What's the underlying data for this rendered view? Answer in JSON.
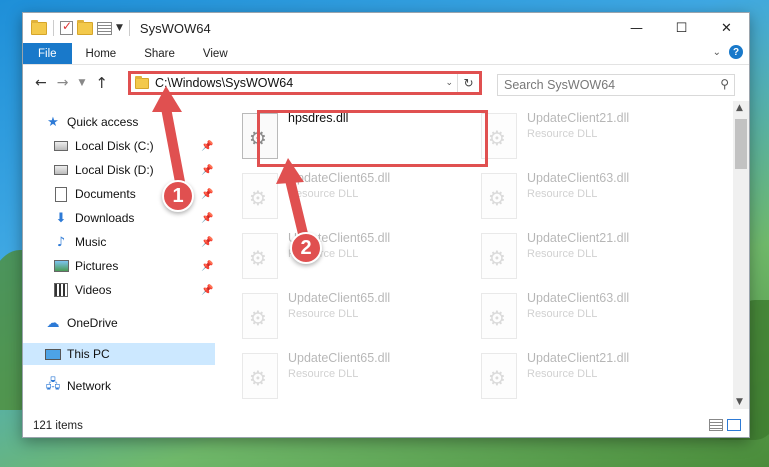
{
  "window": {
    "title": "SysWOW64",
    "controls": [
      "—",
      "☐",
      "✕"
    ]
  },
  "ribbon": {
    "tabs": [
      "File",
      "Home",
      "Share",
      "View"
    ],
    "help": "?"
  },
  "address": {
    "path": "C:\\Windows\\SysWOW64",
    "search_placeholder": "Search SysWOW64"
  },
  "sidebar": {
    "items": [
      {
        "label": "Quick access",
        "icon": "star-icon"
      },
      {
        "label": "Local Disk (C:)",
        "icon": "drive-icon",
        "pinned": true
      },
      {
        "label": "Local Disk (D:)",
        "icon": "drive-icon",
        "pinned": true
      },
      {
        "label": "Documents",
        "icon": "documents-icon",
        "pinned": true
      },
      {
        "label": "Downloads",
        "icon": "downloads-icon",
        "pinned": true
      },
      {
        "label": "Music",
        "icon": "music-icon",
        "pinned": true
      },
      {
        "label": "Pictures",
        "icon": "pictures-icon",
        "pinned": true
      },
      {
        "label": "Videos",
        "icon": "videos-icon",
        "pinned": true
      },
      {
        "label": "OneDrive",
        "icon": "cloud-icon"
      },
      {
        "label": "This PC",
        "icon": "computer-icon",
        "selected": true
      },
      {
        "label": "Network",
        "icon": "network-icon"
      }
    ]
  },
  "files": [
    {
      "name": "hpsdres.dll",
      "type": ""
    },
    {
      "name": "UpdateClient21.dll",
      "type": "Resource DLL"
    },
    {
      "name": "UpdateClient65.dll",
      "type": "Resource DLL"
    },
    {
      "name": "UpdateClient63.dll",
      "type": "Resource DLL"
    },
    {
      "name": "UpdateClient65.dll",
      "type": "Resource DLL"
    },
    {
      "name": "UpdateClient21.dll",
      "type": "Resource DLL"
    },
    {
      "name": "UpdateClient65.dll",
      "type": "Resource DLL"
    },
    {
      "name": "UpdateClient63.dll",
      "type": "Resource DLL"
    },
    {
      "name": "UpdateClient65.dll",
      "type": "Resource DLL"
    },
    {
      "name": "UpdateClient21.dll",
      "type": "Resource DLL"
    }
  ],
  "status": {
    "item_count": "121 items"
  },
  "annotations": {
    "step1": "1",
    "step2": "2",
    "color": "#e05050"
  }
}
